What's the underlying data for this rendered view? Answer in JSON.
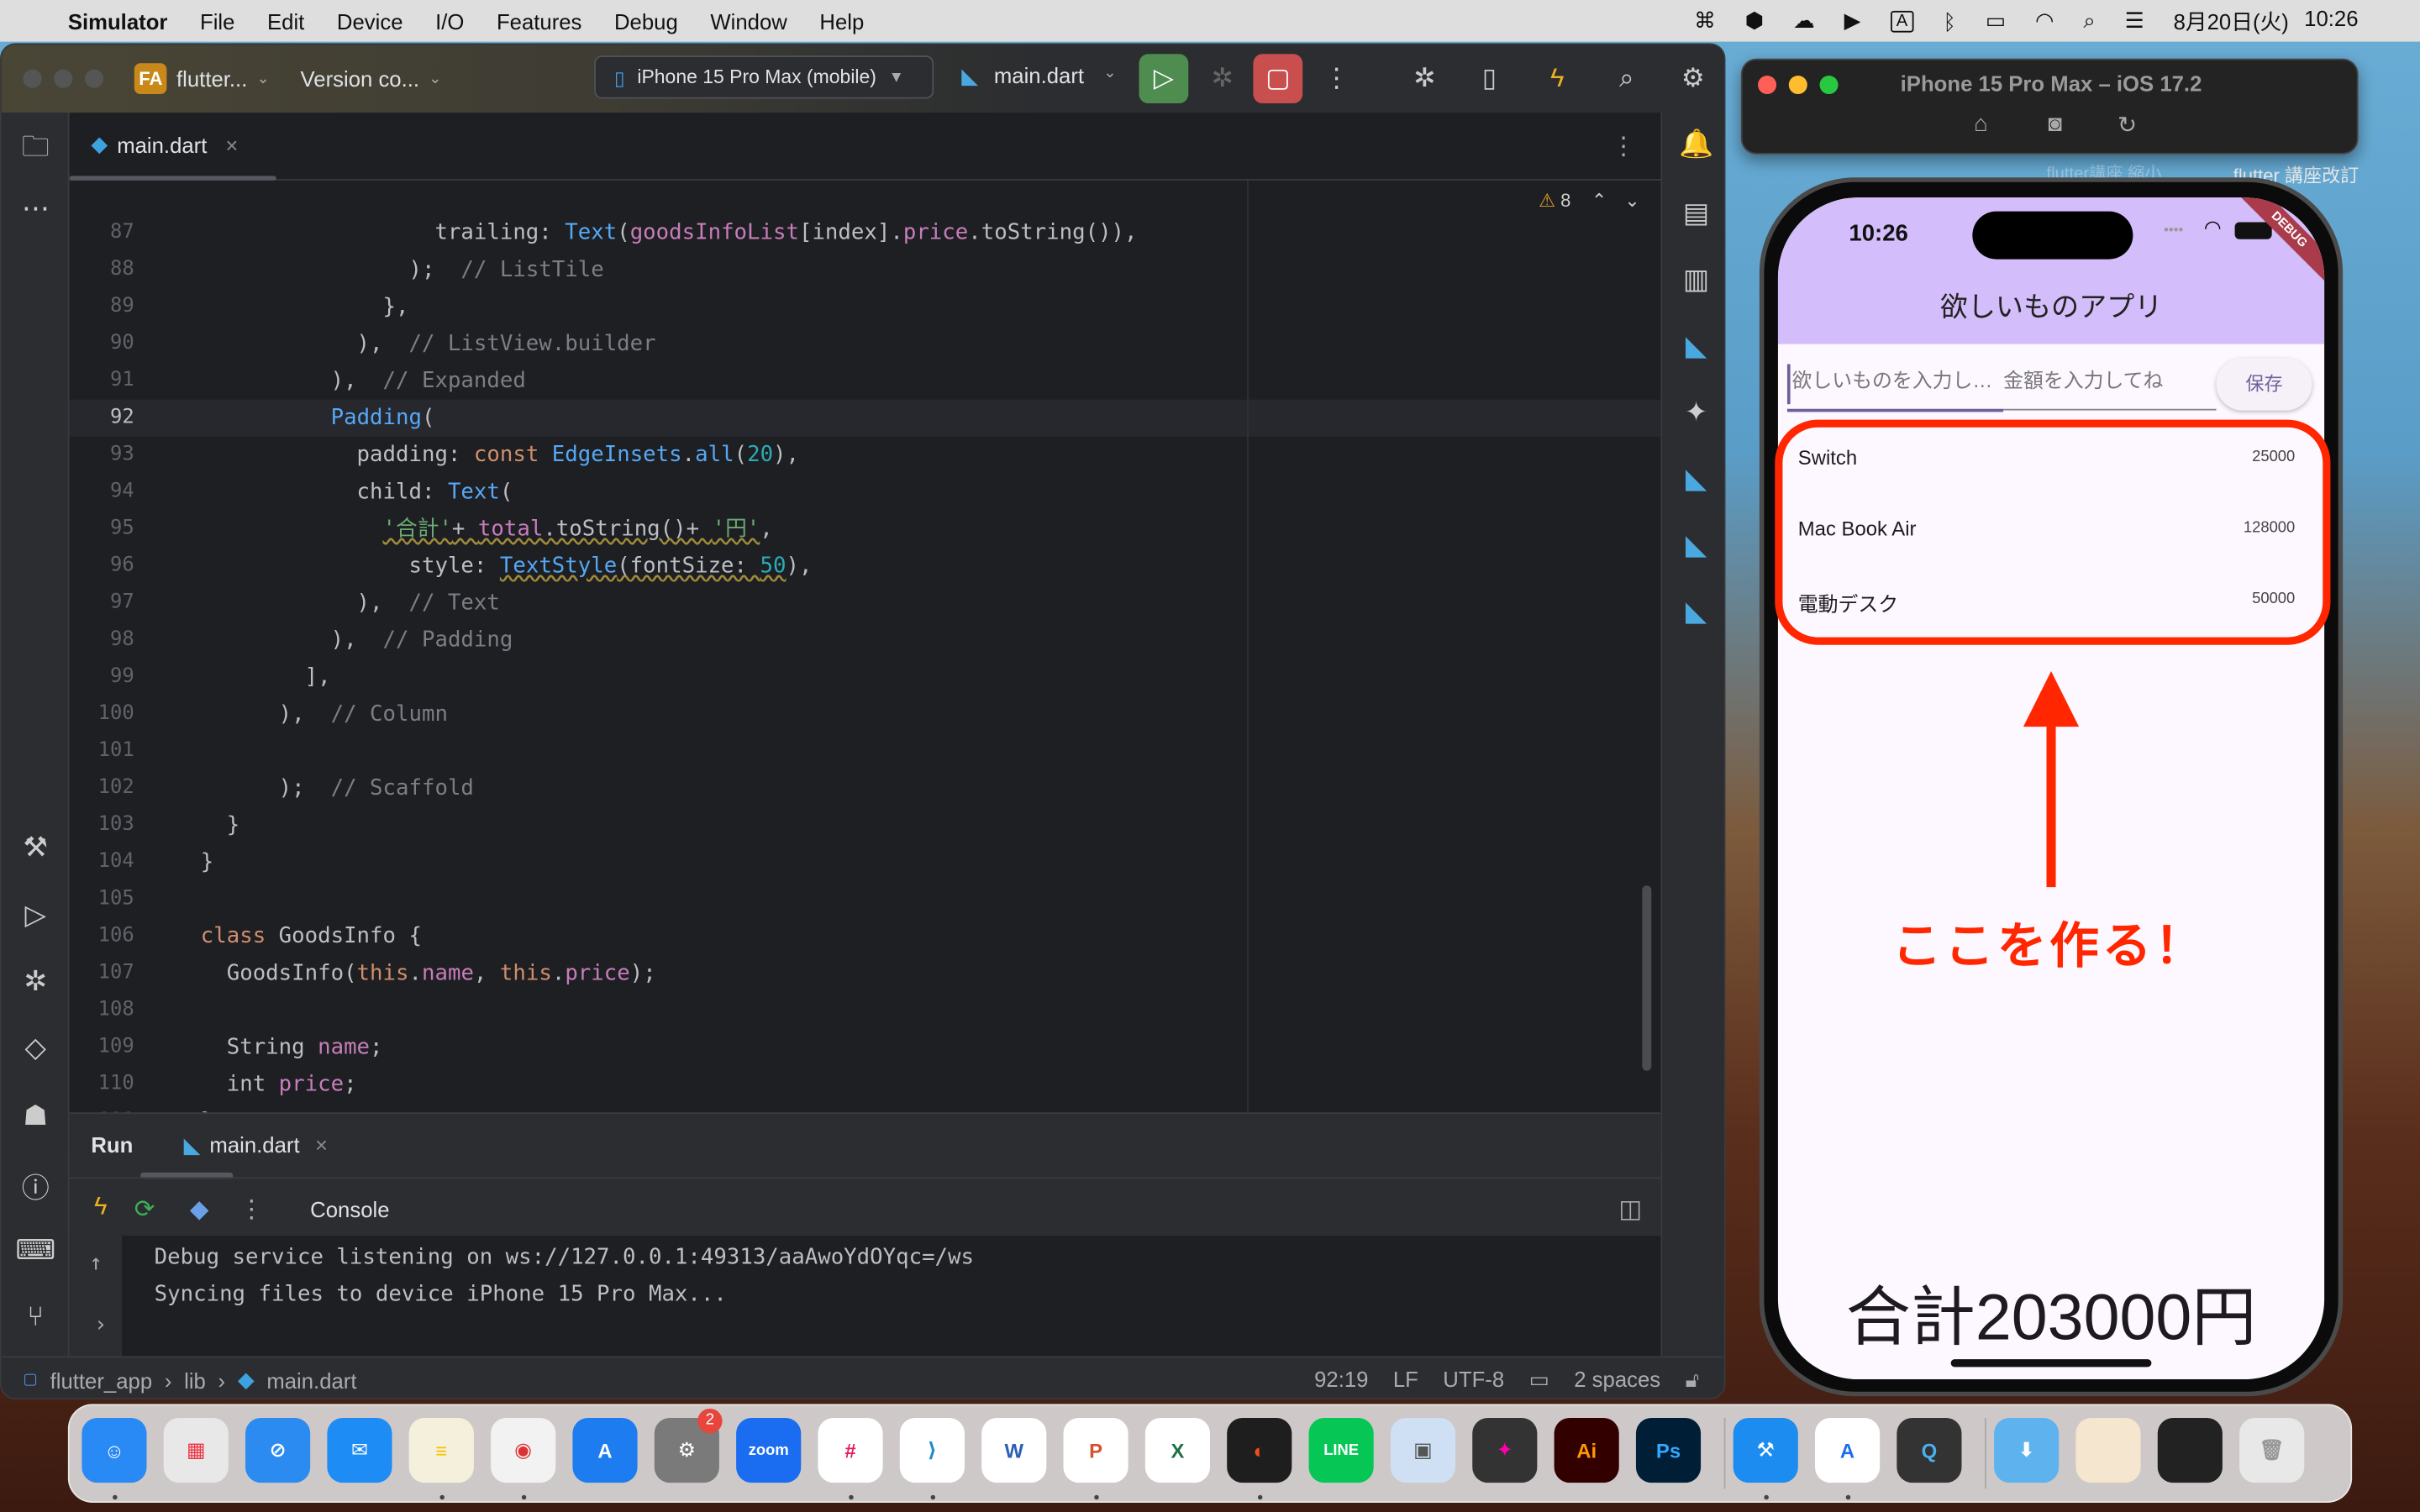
{
  "menubar": {
    "app_name": "Simulator",
    "items": [
      "File",
      "Edit",
      "Device",
      "I/O",
      "Features",
      "Debug",
      "Window",
      "Help"
    ],
    "date": "8月20日(火)",
    "time": "10:26"
  },
  "ide": {
    "project_badge": "FA",
    "project_name": "flutter...",
    "vcs": "Version co...",
    "device": "iPhone 15 Pro Max (mobile)",
    "run_config": "main.dart",
    "tab": "main.dart",
    "warnings": "8",
    "code_lines": [
      {
        "n": "87",
        "t": [
          [
            "                  trailing: ",
            "pl"
          ],
          [
            "Text",
            "ty"
          ],
          [
            "(",
            "pl"
          ],
          [
            "goodsInfoList",
            "fd"
          ],
          [
            "[index].",
            "pl"
          ],
          [
            "price",
            "fd"
          ],
          [
            ".toString()),",
            "pl"
          ]
        ]
      },
      {
        "n": "88",
        "t": [
          [
            "                );  ",
            "pl"
          ],
          [
            "// ListTile",
            "cm"
          ]
        ]
      },
      {
        "n": "89",
        "t": [
          [
            "              },",
            "pl"
          ]
        ]
      },
      {
        "n": "90",
        "t": [
          [
            "            ),  ",
            "pl"
          ],
          [
            "// ListView.builder",
            "cm"
          ]
        ]
      },
      {
        "n": "91",
        "t": [
          [
            "          ),  ",
            "pl"
          ],
          [
            "// Expanded",
            "cm"
          ]
        ]
      },
      {
        "n": "92",
        "t": [
          [
            "          ",
            "pl"
          ],
          [
            "Padding",
            "ty"
          ],
          [
            "(",
            "pl"
          ]
        ]
      },
      {
        "n": "93",
        "t": [
          [
            "            padding: ",
            "pl"
          ],
          [
            "const ",
            "kw"
          ],
          [
            "EdgeInsets",
            "ty"
          ],
          [
            ".",
            "pl"
          ],
          [
            "all",
            "ty"
          ],
          [
            "(",
            "pl"
          ],
          [
            "20",
            "nu"
          ],
          [
            "),",
            "pl"
          ]
        ]
      },
      {
        "n": "94",
        "t": [
          [
            "            child: ",
            "pl"
          ],
          [
            "Text",
            "ty"
          ],
          [
            "(",
            "pl"
          ]
        ]
      },
      {
        "n": "95",
        "t": [
          [
            "              ",
            "pl"
          ],
          [
            "'合計'",
            "st"
          ],
          [
            "+ ",
            "pl"
          ],
          [
            "total",
            "fd"
          ],
          [
            ".toString()+ ",
            "pl"
          ],
          [
            "'円'",
            "st"
          ],
          [
            ",",
            "pl"
          ]
        ]
      },
      {
        "n": "96",
        "t": [
          [
            "                style: ",
            "pl"
          ],
          [
            "TextStyle",
            "ty"
          ],
          [
            "(fontSize: ",
            "pl"
          ],
          [
            "50",
            "nu"
          ],
          [
            "),",
            "pl"
          ]
        ]
      },
      {
        "n": "97",
        "t": [
          [
            "            ),  ",
            "pl"
          ],
          [
            "// Text",
            "cm"
          ]
        ]
      },
      {
        "n": "98",
        "t": [
          [
            "          ),  ",
            "pl"
          ],
          [
            "// Padding",
            "cm"
          ]
        ]
      },
      {
        "n": "99",
        "t": [
          [
            "        ],",
            "pl"
          ]
        ]
      },
      {
        "n": "100",
        "t": [
          [
            "      ),  ",
            "pl"
          ],
          [
            "// Column",
            "cm"
          ]
        ]
      },
      {
        "n": "101",
        "t": []
      },
      {
        "n": "102",
        "t": [
          [
            "      );  ",
            "pl"
          ],
          [
            "// Scaffold",
            "cm"
          ]
        ]
      },
      {
        "n": "103",
        "t": [
          [
            "  }",
            "pl"
          ]
        ]
      },
      {
        "n": "104",
        "t": [
          [
            "}",
            "pl"
          ]
        ]
      },
      {
        "n": "105",
        "t": []
      },
      {
        "n": "106",
        "t": [
          [
            "class ",
            "kw"
          ],
          [
            "GoodsInfo {",
            "pl"
          ]
        ]
      },
      {
        "n": "107",
        "t": [
          [
            "  GoodsInfo(",
            "pl"
          ],
          [
            "this",
            "kw"
          ],
          [
            ".",
            "pl"
          ],
          [
            "name",
            "fd"
          ],
          [
            ", ",
            "pl"
          ],
          [
            "this",
            "kw"
          ],
          [
            ".",
            "pl"
          ],
          [
            "price",
            "fd"
          ],
          [
            ");",
            "pl"
          ]
        ]
      },
      {
        "n": "108",
        "t": []
      },
      {
        "n": "109",
        "t": [
          [
            "  String ",
            "pl"
          ],
          [
            "name",
            "fd"
          ],
          [
            ";",
            "pl"
          ]
        ]
      },
      {
        "n": "110",
        "t": [
          [
            "  int ",
            "pl"
          ],
          [
            "price",
            "fd"
          ],
          [
            ";",
            "pl"
          ]
        ]
      },
      {
        "n": "111",
        "t": [
          [
            "}",
            "pl"
          ]
        ]
      }
    ],
    "current_line": "92",
    "run": {
      "title": "Run",
      "tab": "main.dart",
      "console_label": "Console",
      "console_lines": [
        "Debug service listening on ws://127.0.0.1:49313/aaAwoYdOYqc=/ws",
        "Syncing files to device iPhone 15 Pro Max..."
      ]
    },
    "status": {
      "breadcrumb": [
        "flutter_app",
        "lib",
        "main.dart"
      ],
      "position": "92:19",
      "line_sep": "LF",
      "encoding": "UTF-8",
      "indent": "2 spaces"
    }
  },
  "desktop": {
    "folder1": "flutter講座 縮小",
    "folder2": "flutter 講座改訂"
  },
  "simulator": {
    "title": "iPhone 15 Pro Max – iOS 17.2",
    "status_time": "10:26",
    "debug_banner": "DEBUG",
    "app_title": "欲しいものアプリ",
    "name_placeholder": "欲しいものを入力し…",
    "price_placeholder": "金額を入力してね",
    "save_label": "保存",
    "items": [
      {
        "name": "Switch",
        "price": "25000"
      },
      {
        "name": "Mac Book Air",
        "price": "128000"
      },
      {
        "name": "電動デスク",
        "price": "50000"
      }
    ],
    "total": "合計203000円",
    "app_bar_color": "#d3bdfa"
  },
  "annotation": {
    "text": "ここを作る！",
    "color": "#ff2600"
  },
  "dock": [
    {
      "name": "finder",
      "label": "☺",
      "bg": "#2a8af5",
      "dot": true
    },
    {
      "name": "launchpad",
      "label": "▦",
      "bg": "#e8e8e8",
      "fg": "#e34",
      "dot": false
    },
    {
      "name": "safari",
      "label": "⊘",
      "bg": "#2b8bf0",
      "dot": false
    },
    {
      "name": "mail",
      "label": "✉",
      "bg": "#1e8cf5",
      "dot": false
    },
    {
      "name": "notes",
      "label": "≡",
      "bg": "#f5f0dc",
      "fg": "#f5c400",
      "dot": true
    },
    {
      "name": "chrome",
      "label": "◉",
      "bg": "#f2f2f2",
      "fg": "#d33",
      "dot": true
    },
    {
      "name": "app-store",
      "label": "A",
      "bg": "#1c7cf0",
      "dot": false
    },
    {
      "name": "system-settings",
      "label": "⚙",
      "bg": "#7a7a7a",
      "badge": "2",
      "dot": false
    },
    {
      "name": "zoom",
      "label": "zoom",
      "bg": "#1a6cf0",
      "dot": false
    },
    {
      "name": "slack",
      "label": "#",
      "bg": "#ffffff",
      "fg": "#e01e5a",
      "dot": true
    },
    {
      "name": "vscode",
      "label": "⟩",
      "bg": "#ffffff",
      "fg": "#1f8ad2",
      "dot": true
    },
    {
      "name": "word",
      "label": "W",
      "bg": "#ffffff",
      "fg": "#2b5fb8",
      "dot": false
    },
    {
      "name": "powerpoint",
      "label": "P",
      "bg": "#ffffff",
      "fg": "#d35230",
      "dot": true
    },
    {
      "name": "excel",
      "label": "X",
      "bg": "#ffffff",
      "fg": "#1e7145",
      "dot": false
    },
    {
      "name": "figma",
      "label": "◐",
      "bg": "#1e1e1e",
      "fg": "#f24e1e",
      "dot": true
    },
    {
      "name": "line",
      "label": "LINE",
      "bg": "#06c755",
      "dot": false
    },
    {
      "name": "preview",
      "label": "▣",
      "bg": "#cfe0f5",
      "fg": "#555",
      "dot": false
    },
    {
      "name": "final-cut",
      "label": "✦",
      "bg": "#333",
      "fg": "#f0a",
      "dot": false
    },
    {
      "name": "illustrator",
      "label": "Ai",
      "bg": "#330000",
      "fg": "#ff9a00",
      "dot": false
    },
    {
      "name": "photoshop",
      "label": "Ps",
      "bg": "#001e36",
      "fg": "#31a8ff",
      "dot": false
    },
    {
      "name": "xcode",
      "label": "⚒",
      "bg": "#1c8cf0",
      "dot": true
    },
    {
      "name": "instruments",
      "label": "A",
      "bg": "#ffffff",
      "fg": "#1c6cf0",
      "dot": true
    },
    {
      "name": "quicktime",
      "label": "Q",
      "bg": "#333",
      "fg": "#4ab0f0",
      "dot": false
    },
    {
      "name": "downloads",
      "label": "⬇",
      "bg": "#5eb2ee",
      "dot": false
    },
    {
      "name": "recent-doc-1",
      "label": "",
      "bg": "#f5e6d0",
      "dot": false
    },
    {
      "name": "recent-doc-2",
      "label": "",
      "bg": "#222",
      "dot": false
    },
    {
      "name": "trash",
      "label": "🗑",
      "bg": "#e8e8e8",
      "fg": "#999",
      "dot": false
    }
  ]
}
